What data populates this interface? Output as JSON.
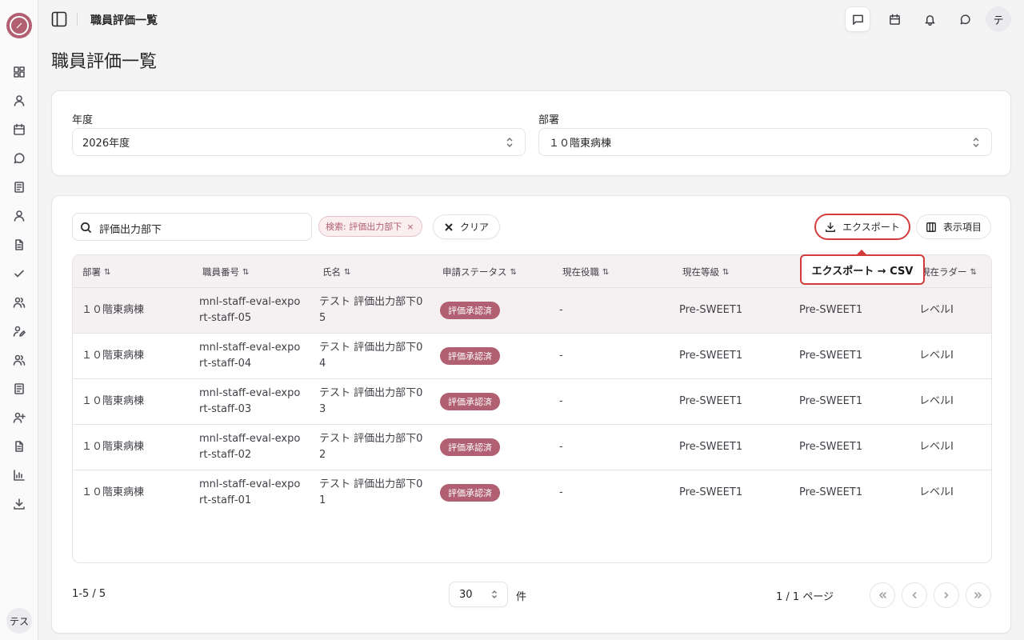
{
  "header": {
    "title": "職員評価一覧",
    "user_initial": "テ"
  },
  "sidebar": {
    "user_initial": "テス",
    "items": [
      "dashboard",
      "user",
      "calendar",
      "chat",
      "book",
      "person",
      "document",
      "check",
      "users",
      "user-edit",
      "users-2",
      "notebook",
      "user-plus",
      "file",
      "chart",
      "download"
    ]
  },
  "page": {
    "title": "職員評価一覧"
  },
  "filters": {
    "year_label": "年度",
    "year_value": "2026年度",
    "dept_label": "部署",
    "dept_value": "１０階東病棟"
  },
  "toolbar": {
    "search_value": "評価出力部下",
    "chip_label": "検索: 評価出力部下",
    "chip_close": "×",
    "clear_label": "クリア",
    "export_label": "エクスポート",
    "columns_label": "表示項目",
    "tooltip": "エクスポート → CSV"
  },
  "table": {
    "columns": [
      "部署",
      "職員番号",
      "氏名",
      "申請ステータス",
      "現在役職",
      "現在等級",
      "",
      "現在ラダー"
    ],
    "sort_icon": "⇅",
    "rows": [
      {
        "dept": "１０階東病棟",
        "id_1": "mnl-staff-eval-expo",
        "id_2": "rt-staff-05",
        "name_1": "テスト 評価出力部下0",
        "name_2": "5",
        "status": "評価承認済",
        "role": "-",
        "grade": "Pre-SWEET1",
        "grade2": "Pre-SWEET1",
        "ladder": "レベルI"
      },
      {
        "dept": "１０階東病棟",
        "id_1": "mnl-staff-eval-expo",
        "id_2": "rt-staff-04",
        "name_1": "テスト 評価出力部下0",
        "name_2": "4",
        "status": "評価承認済",
        "role": "-",
        "grade": "Pre-SWEET1",
        "grade2": "Pre-SWEET1",
        "ladder": "レベルI"
      },
      {
        "dept": "１０階東病棟",
        "id_1": "mnl-staff-eval-expo",
        "id_2": "rt-staff-03",
        "name_1": "テスト 評価出力部下0",
        "name_2": "3",
        "status": "評価承認済",
        "role": "-",
        "grade": "Pre-SWEET1",
        "grade2": "Pre-SWEET1",
        "ladder": "レベルI"
      },
      {
        "dept": "１０階東病棟",
        "id_1": "mnl-staff-eval-expo",
        "id_2": "rt-staff-02",
        "name_1": "テスト 評価出力部下0",
        "name_2": "2",
        "status": "評価承認済",
        "role": "-",
        "grade": "Pre-SWEET1",
        "grade2": "Pre-SWEET1",
        "ladder": "レベルI"
      },
      {
        "dept": "１０階東病棟",
        "id_1": "mnl-staff-eval-expo",
        "id_2": "rt-staff-01",
        "name_1": "テスト 評価出力部下0",
        "name_2": "1",
        "status": "評価承認済",
        "role": "-",
        "grade": "Pre-SWEET1",
        "grade2": "Pre-SWEET1",
        "ladder": "レベルI"
      }
    ]
  },
  "footer": {
    "range": "1-5 / 5",
    "per_page": "30",
    "per_page_unit": "件",
    "page_info": "1 / 1 ページ"
  },
  "colors": {
    "accent": "#b06070",
    "highlight": "#d43c3c",
    "row_highlight": "#f5f0f1"
  }
}
